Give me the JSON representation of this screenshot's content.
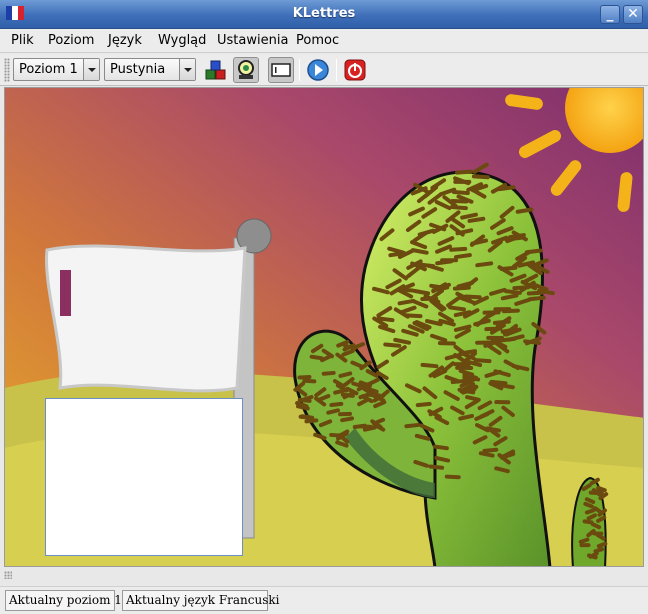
{
  "window": {
    "title": "KLettres",
    "app_icon": "french-flag-icon",
    "controls": [
      "minimize-icon",
      "close-icon"
    ]
  },
  "menubar": {
    "items": [
      {
        "label": "Plik"
      },
      {
        "label": "Poziom"
      },
      {
        "label": "Język"
      },
      {
        "label": "Wygląd"
      },
      {
        "label": "Ustawienia"
      },
      {
        "label": "Pomoc"
      }
    ]
  },
  "toolbar": {
    "level_combo": {
      "value": "Poziom 1"
    },
    "theme_combo": {
      "value": "Pustynia"
    },
    "tools": [
      {
        "icon": "blocks-icon"
      },
      {
        "icon": "grown-up-mode-icon",
        "pressed": true
      },
      {
        "icon": "menubar-toggle-icon",
        "pressed": true
      },
      {
        "icon": "play-next-icon"
      },
      {
        "icon": "quit-icon"
      }
    ]
  },
  "scene": {
    "theme": "desert",
    "flag_letter_visible": true,
    "input_value": ""
  },
  "statusbar": {
    "level": "Aktualny poziom 1",
    "language": "Aktualny język Francuski"
  },
  "colors": {
    "title_bar": "#3f6fb8",
    "sky_top": "#8a3a6a",
    "sky_mid": "#c8664a",
    "sand": "#d8cf4a",
    "cactus": "#6fa82a",
    "sun": "#f5b31a"
  }
}
